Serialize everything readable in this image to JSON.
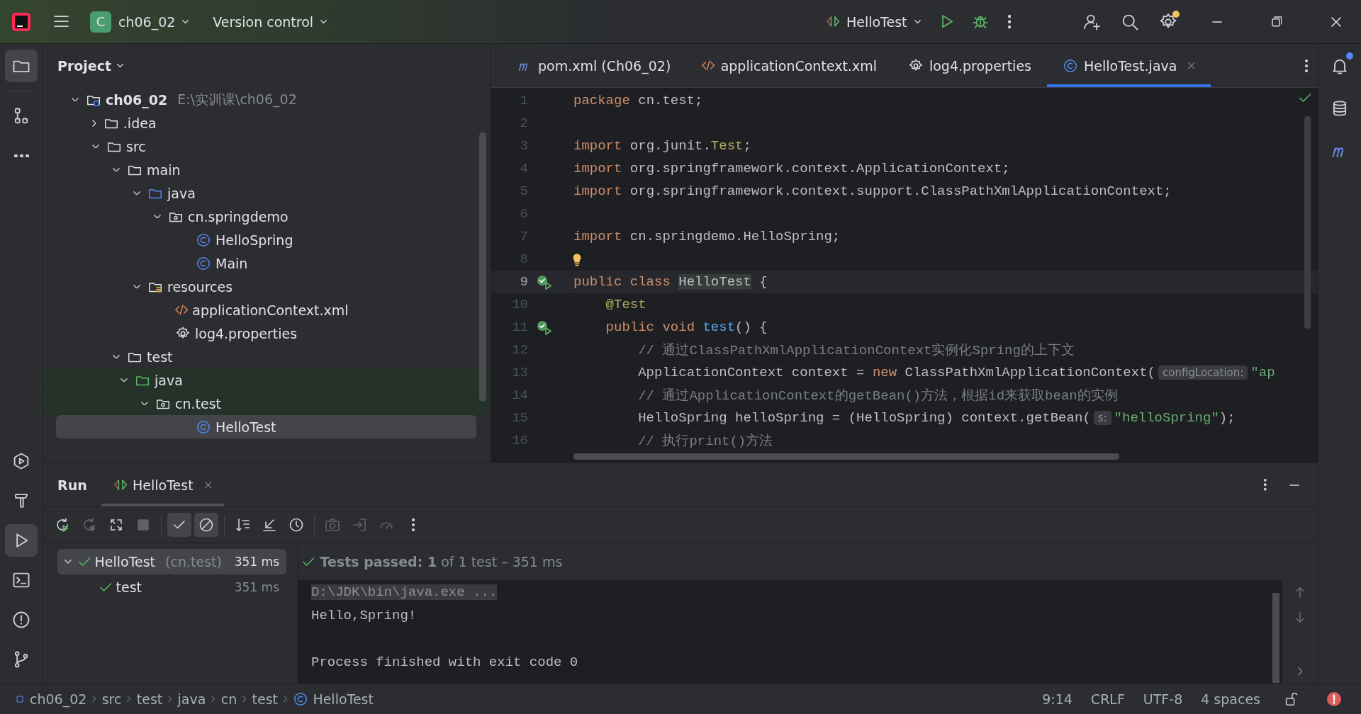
{
  "title_bar": {
    "project_badge": "C",
    "project": "ch06_02",
    "vcs": "Version control",
    "run_config": "HelloTest",
    "settings_badge": true
  },
  "left_strip": [
    {
      "kind": "folder",
      "selected": true
    },
    {
      "kind": "structure",
      "selected": false
    },
    {
      "kind": "more",
      "selected": false
    }
  ],
  "left_strip_bottom": [
    {
      "kind": "services",
      "selected": false
    },
    {
      "kind": "build",
      "selected": false
    },
    {
      "kind": "run",
      "selected": true
    },
    {
      "kind": "terminal",
      "selected": false
    },
    {
      "kind": "problems",
      "selected": false
    },
    {
      "kind": "git",
      "selected": false
    }
  ],
  "right_strip": [
    {
      "kind": "bell",
      "badge": true
    },
    {
      "kind": "database",
      "badge": false
    },
    {
      "kind": "maven",
      "badge": false
    }
  ],
  "project_panel": {
    "title": "Project",
    "tree": [
      {
        "name": "ch06_02",
        "path": "E:\\实训课\\ch06_02",
        "kind": "module",
        "expanded": true,
        "selected": false,
        "highlighted": false,
        "children": [
          {
            "name": ".idea",
            "kind": "folder",
            "expanded": false,
            "selected": false,
            "highlighted": false
          },
          {
            "name": "src",
            "kind": "folder",
            "expanded": true,
            "selected": false,
            "highlighted": false,
            "children": [
              {
                "name": "main",
                "kind": "folder",
                "expanded": true,
                "selected": false,
                "highlighted": false,
                "children": [
                  {
                    "name": "java",
                    "kind": "source-folder",
                    "expanded": true,
                    "selected": false,
                    "highlighted": false,
                    "children": [
                      {
                        "name": "cn.springdemo",
                        "kind": "package",
                        "expanded": true,
                        "selected": false,
                        "highlighted": false,
                        "children": [
                          {
                            "name": "HelloSpring",
                            "kind": "class",
                            "selected": false,
                            "highlighted": false
                          },
                          {
                            "name": "Main",
                            "kind": "class",
                            "selected": false,
                            "highlighted": false
                          }
                        ]
                      }
                    ]
                  },
                  {
                    "name": "resources",
                    "kind": "resources",
                    "expanded": true,
                    "selected": false,
                    "highlighted": false,
                    "children": [
                      {
                        "name": "applicationContext.xml",
                        "kind": "xml",
                        "selected": false,
                        "highlighted": false
                      },
                      {
                        "name": "log4.properties",
                        "kind": "properties",
                        "selected": false,
                        "highlighted": false
                      }
                    ]
                  }
                ]
              },
              {
                "name": "test",
                "kind": "folder",
                "expanded": true,
                "selected": false,
                "highlighted": false,
                "children": [
                  {
                    "name": "java",
                    "kind": "test-folder",
                    "expanded": true,
                    "selected": false,
                    "highlighted": true,
                    "children": [
                      {
                        "name": "cn.test",
                        "kind": "package",
                        "expanded": true,
                        "selected": false,
                        "highlighted": true,
                        "children": [
                          {
                            "name": "HelloTest",
                            "kind": "class",
                            "selected": true,
                            "highlighted": false
                          }
                        ]
                      }
                    ]
                  }
                ]
              }
            ]
          }
        ]
      }
    ]
  },
  "editor_tabs": [
    {
      "label": "pom.xml (Ch06_02)",
      "kind": "maven",
      "selected": false,
      "closable": false
    },
    {
      "label": "applicationContext.xml",
      "kind": "xml",
      "selected": false,
      "closable": false
    },
    {
      "label": "log4.properties",
      "kind": "properties",
      "selected": false,
      "closable": false
    },
    {
      "label": "HelloTest.java",
      "kind": "class",
      "selected": true,
      "closable": true
    }
  ],
  "code": [
    {
      "number": "1",
      "current": false,
      "tokens": [
        {
          "kind": "kw",
          "text": "package"
        },
        {
          "kind": "plain",
          "text": " cn.test;"
        }
      ]
    },
    {
      "number": "2",
      "current": false,
      "kind": "blank"
    },
    {
      "number": "3",
      "current": false,
      "tokens": [
        {
          "kind": "kw",
          "text": "import"
        },
        {
          "kind": "plain",
          "text": " org.junit."
        },
        {
          "kind": "type",
          "text": "Test"
        },
        {
          "kind": "plain",
          "text": ";"
        }
      ]
    },
    {
      "number": "4",
      "current": false,
      "tokens": [
        {
          "kind": "kw",
          "text": "import"
        },
        {
          "kind": "plain",
          "text": " org.springframework.context.ApplicationContext;"
        }
      ]
    },
    {
      "number": "5",
      "current": false,
      "tokens": [
        {
          "kind": "kw",
          "text": "import"
        },
        {
          "kind": "plain",
          "text": " org.springframework.context.support.ClassPathXmlApplicationContext;"
        }
      ]
    },
    {
      "number": "6",
      "current": false,
      "kind": "blank"
    },
    {
      "number": "7",
      "current": false,
      "tokens": [
        {
          "kind": "kw",
          "text": "import"
        },
        {
          "kind": "plain",
          "text": " cn.springdemo.HelloSpring;"
        }
      ]
    },
    {
      "number": "8",
      "current": false,
      "kind": "bulb"
    },
    {
      "number": "9",
      "current": true,
      "kind": "run",
      "tokens": [
        {
          "kind": "kw",
          "text": "public class "
        },
        {
          "kind": "usage",
          "text": "HelloTest"
        },
        {
          "kind": "plain",
          "text": " {"
        }
      ]
    },
    {
      "number": "10",
      "current": false,
      "tokens": [
        {
          "kind": "type",
          "text": "    @Test"
        }
      ]
    },
    {
      "number": "11",
      "current": false,
      "kind": "run",
      "tokens": [
        {
          "kind": "kw",
          "text": "    public void "
        },
        {
          "kind": "fn",
          "text": "test"
        },
        {
          "kind": "plain",
          "text": "() {"
        }
      ]
    },
    {
      "number": "12",
      "current": false,
      "tokens": [
        {
          "kind": "comment",
          "text": "        // 通过ClassPathXmlApplicationContext实例化Spring的上下文"
        }
      ]
    },
    {
      "number": "13",
      "current": false,
      "tokens": [
        {
          "kind": "plain",
          "text": "        ApplicationContext context = "
        },
        {
          "kind": "kw",
          "text": "new"
        },
        {
          "kind": "plain",
          "text": " ClassPathXmlApplicationContext("
        },
        {
          "kind": "hint",
          "text": "configLocation:"
        },
        {
          "kind": "str",
          "text": "\"ap"
        }
      ]
    },
    {
      "number": "14",
      "current": false,
      "tokens": [
        {
          "kind": "comment",
          "text": "        // 通过ApplicationContext的getBean()方法，根据id来获取bean的实例"
        }
      ]
    },
    {
      "number": "15",
      "current": false,
      "tokens": [
        {
          "kind": "plain",
          "text": "        HelloSpring helloSpring = (HelloSpring) context.getBean("
        },
        {
          "kind": "hint",
          "text": "s:"
        },
        {
          "kind": "str",
          "text": "\"helloSpring\""
        },
        {
          "kind": "plain",
          "text": ");"
        }
      ]
    },
    {
      "number": "16",
      "current": false,
      "tokens": [
        {
          "kind": "comment",
          "text": "        // 执行print()方法"
        }
      ]
    }
  ],
  "run_panel": {
    "title": "Run",
    "tab": "HelloTest",
    "toolbar": [
      {
        "kind": "rerun",
        "disabled": false,
        "on": false
      },
      {
        "kind": "rerun-failed",
        "disabled": true,
        "on": false
      },
      {
        "kind": "auto-test",
        "disabled": false,
        "on": false
      },
      {
        "kind": "stop",
        "disabled": true,
        "on": false
      },
      {
        "kind": "passed",
        "disabled": false,
        "on": true
      },
      {
        "kind": "ignored",
        "disabled": false,
        "on": true
      },
      {
        "kind": "sort",
        "disabled": false,
        "on": false
      },
      {
        "kind": "collapse",
        "disabled": false,
        "on": false
      },
      {
        "kind": "history",
        "disabled": false,
        "on": false
      },
      {
        "kind": "camera",
        "disabled": true,
        "on": false
      },
      {
        "kind": "import",
        "disabled": true,
        "on": false
      },
      {
        "kind": "gauge",
        "disabled": true,
        "on": false
      },
      {
        "kind": "more",
        "disabled": false,
        "on": false
      }
    ],
    "tests": [
      {
        "name": "HelloTest",
        "package": "(cn.test)",
        "time": "351 ms",
        "selected": true,
        "expanded": true,
        "children": [
          {
            "name": "test",
            "time": "351 ms",
            "selected": false
          }
        ]
      }
    ],
    "summary": "**Tests passed: 1** of 1 test – 351 ms",
    "console": [
      {
        "text": "D:\\JDK\\bin\\java.exe ...",
        "kind": "command"
      },
      {
        "text": "Hello,Spring!",
        "kind": "output"
      },
      {
        "text": "Process finished with exit code 0",
        "kind": "exit"
      }
    ]
  },
  "status_bar": {
    "breadcrumbs": [
      {
        "label": "ch06_02",
        "kind": "module"
      },
      {
        "label": "src",
        "kind": "folder"
      },
      {
        "label": "test",
        "kind": "folder"
      },
      {
        "label": "java",
        "kind": "folder"
      },
      {
        "label": "cn",
        "kind": "folder"
      },
      {
        "label": "test",
        "kind": "folder"
      },
      {
        "label": "HelloTest",
        "kind": "class"
      }
    ],
    "items": [
      "9:14",
      "CRLF",
      "UTF-8",
      "4 spaces"
    ],
    "has_errors": true
  }
}
